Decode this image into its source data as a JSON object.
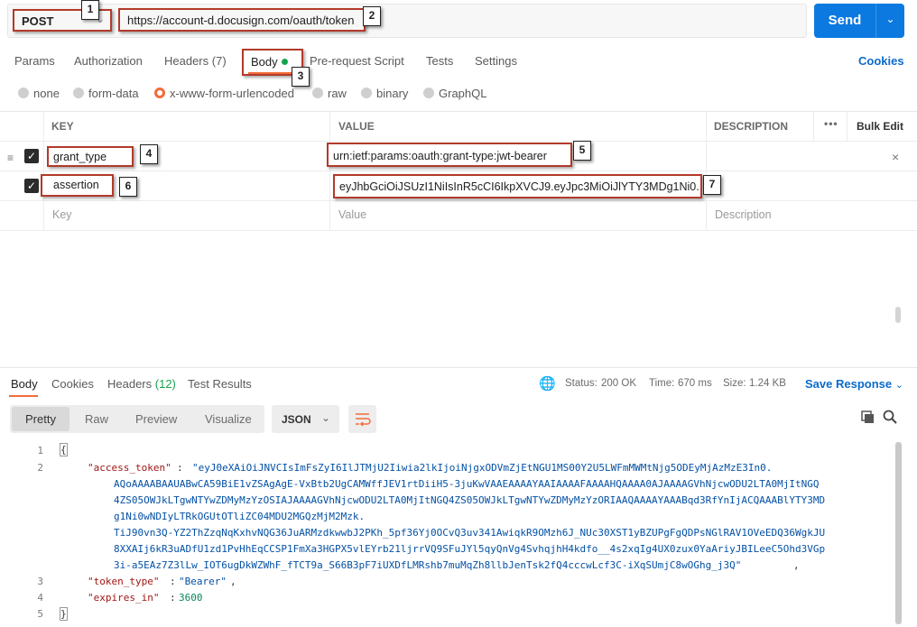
{
  "request": {
    "method": "POST",
    "url": "https://account-d.docusign.com/oauth/token",
    "send_label": "Send"
  },
  "request_tabs": [
    {
      "label": "Params"
    },
    {
      "label": "Authorization"
    },
    {
      "label": "Headers",
      "count": "(7)"
    },
    {
      "label": "Body"
    },
    {
      "label": "Pre-request Script"
    },
    {
      "label": "Tests"
    },
    {
      "label": "Settings"
    }
  ],
  "cookies_link": "Cookies",
  "body_modes": [
    {
      "label": "none"
    },
    {
      "label": "form-data"
    },
    {
      "label": "x-www-form-urlencoded",
      "selected": true
    },
    {
      "label": "raw"
    },
    {
      "label": "binary"
    },
    {
      "label": "GraphQL"
    }
  ],
  "table": {
    "headers": {
      "key": "KEY",
      "value": "VALUE",
      "description": "DESCRIPTION",
      "bulk_edit": "Bulk Edit"
    },
    "rows": [
      {
        "key": "grant_type",
        "value": "urn:ietf:params:oauth:grant-type:jwt-bearer",
        "checked": true
      },
      {
        "key": "assertion",
        "value": "eyJhbGciOiJSUzI1NiIsInR5cCI6IkpXVCJ9.eyJpc3MiOiJlYTY3MDg1Ni0...",
        "checked": true
      }
    ],
    "placeholders": {
      "key": "Key",
      "value": "Value",
      "description": "Description"
    }
  },
  "annotations": [
    "1",
    "2",
    "3",
    "4",
    "5",
    "6",
    "7"
  ],
  "response": {
    "tabs": [
      {
        "label": "Body"
      },
      {
        "label": "Cookies"
      },
      {
        "label": "Headers",
        "count": "(12)"
      },
      {
        "label": "Test Results"
      }
    ],
    "status_label": "Status:",
    "status_value": "200 OK",
    "time_label": "Time:",
    "time_value": "670 ms",
    "size_label": "Size:",
    "size_value": "1.24 KB",
    "save_label": "Save Response",
    "views": [
      "Pretty",
      "Raw",
      "Preview",
      "Visualize"
    ],
    "format": "JSON",
    "line_numbers": [
      "1",
      "2",
      "3",
      "4",
      "5"
    ],
    "open_brace": "{",
    "close_brace": "}",
    "access_token_key": "\"access_token\"",
    "access_token_lines": [
      "\"eyJ0eXAiOiJNVCIsImFsZyI6IlJTMjU2Iiwia2lkIjoiNjgxODVmZjEtNGU1MS00Y2U5LWFmMWMtNjg5ODEyMjAzMzE3In0.",
      "AQoAAAABAAUABwCA59BiE1vZSAgAgE-VxBtb2UgCAMWffJEV1rtDiiH5-3juKwVAAEAAAAYAAIAAAAFAAAAHQAAAA0AJAAAAGVhNjcwODU2LTA0MjItNGQ",
      "4ZS05OWJkLTgwNTYwZDMyMzYzOSIAJAAAAGVhNjcwODU2LTA0MjItNGQ4ZS05OWJkLTgwNTYwZDMyMzYzORIAAQAAAAYAAABqd3RfYnIjACQAAABlYTY3MD",
      "g1Ni0wNDIyLTRkOGUtOTliZC04MDU2MGQzMjM2Mzk.",
      "TiJ90vn3Q-YZ2ThZzqNqKxhvNQG36JuARMzdkwwbJ2PKh_5pf36Yj0OCvQ3uv341AwiqkR9OMzh6J_NUc30XST1yBZUPgFgQDPsNGlRAV1OVeEDQ36WgkJU",
      "8XXAIj6kR3uADfU1zd1PvHhEqCCSP1FmXa3HGPX5vlEYrb21ljrrVQ9SFuJYl5qyQnVg4SvhqjhH4kdfo__4s2xqIg4UX0zux0YaAriyJBILeeC5Ohd3VGp",
      "3i-a5EAz7Z3lLw_IOT6ugDkWZWhF_fTCT9a_S66B3pF7iUXDfLMRshb7muMqZh8llbJenTsk2fQ4cccwLcf3C-iXqSUmjC8wOGhg_j3Q\""
    ],
    "token_type_key": "\"token_type\"",
    "token_type_value": "\"Bearer\"",
    "expires_in_key": "\"expires_in\"",
    "expires_in_value": "3600"
  }
}
